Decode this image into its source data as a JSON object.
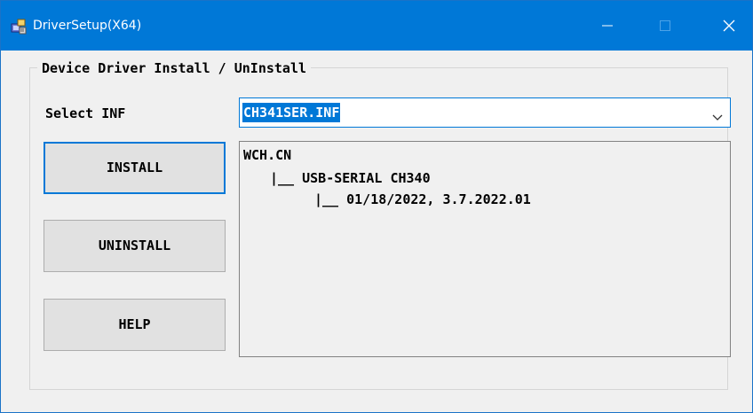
{
  "window": {
    "title": "DriverSetup(X64)",
    "icons": {
      "app": "installer-icon",
      "minimize": "minimize-icon",
      "maximize": "maximize-icon",
      "close": "close-icon"
    }
  },
  "group": {
    "legend": "Device Driver Install / UnInstall"
  },
  "select_inf": {
    "label": "Select INF",
    "selected_value": "CH341SER.INF",
    "dropdown_icon": "chevron-down-icon"
  },
  "buttons": {
    "install": "INSTALL",
    "uninstall": "UNINSTALL",
    "help": "HELP"
  },
  "info": {
    "lines": [
      "WCH.CN",
      "|__ USB-SERIAL CH340",
      "|__ 01/18/2022, 3.7.2022.01"
    ]
  },
  "colors": {
    "titlebar": "#0078d7",
    "selection": "#0078d7",
    "window_bg": "#f0f0f0",
    "button_bg": "#e1e1e1"
  }
}
